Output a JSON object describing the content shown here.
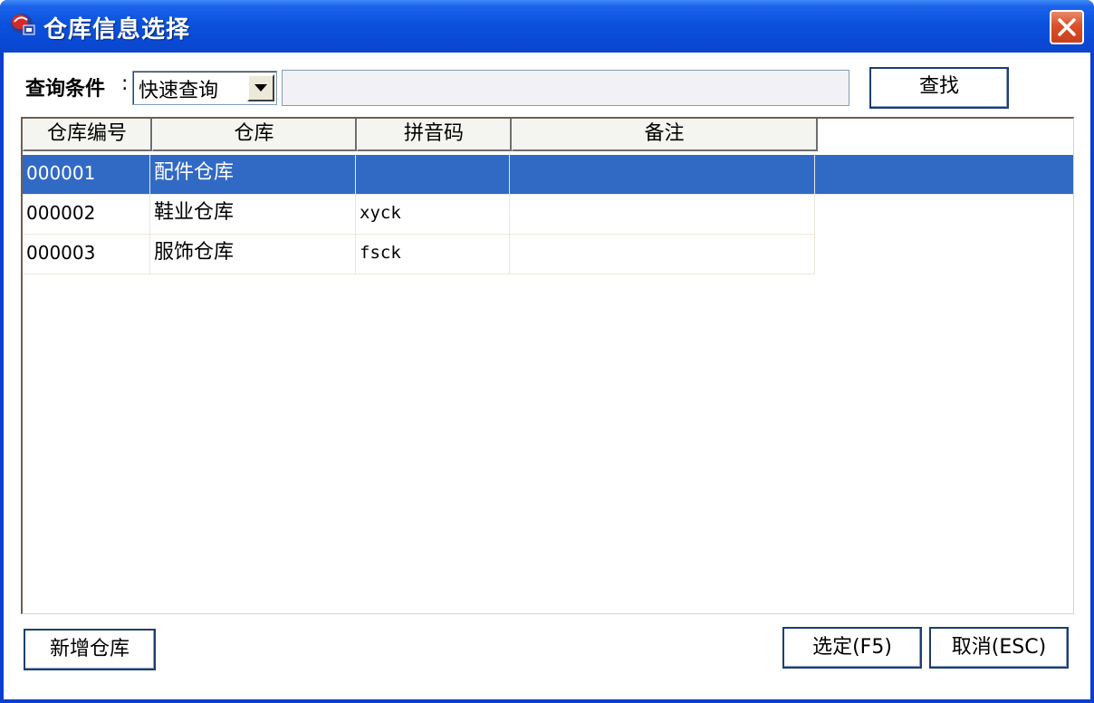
{
  "window": {
    "title": "仓库信息选择",
    "close_icon": "close-icon"
  },
  "query": {
    "label": "查询条件",
    "colon": ":",
    "mode_selected": "快速查询",
    "search_value": "",
    "find_label": "查找"
  },
  "grid": {
    "columns": [
      "仓库编号",
      "仓库",
      "拼音码",
      "备注"
    ],
    "rows": [
      {
        "code": "000001",
        "name": "配件仓库",
        "pinyin": "",
        "note": "",
        "selected": true
      },
      {
        "code": "000002",
        "name": "鞋业仓库",
        "pinyin": "xyck",
        "note": "",
        "selected": false
      },
      {
        "code": "000003",
        "name": "服饰仓库",
        "pinyin": "fsck",
        "note": "",
        "selected": false
      }
    ]
  },
  "footer": {
    "add_label": "新增仓库",
    "ok_label": "选定(F5)",
    "cancel_label": "取消(ESC)"
  },
  "colors": {
    "title_bar": "#0a52dc",
    "selection": "#316ac5",
    "close_button": "#d9502a"
  }
}
